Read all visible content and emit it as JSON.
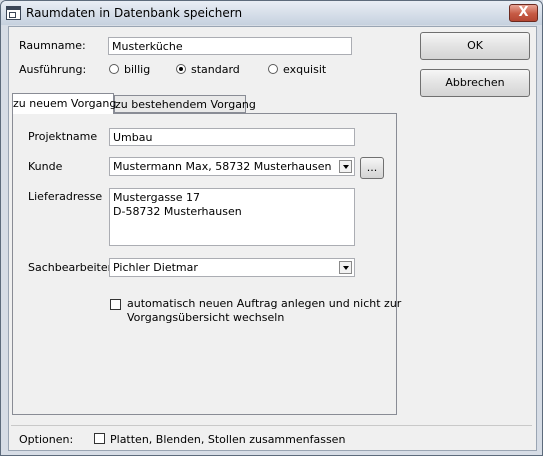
{
  "window": {
    "title": "Raumdaten in Datenbank speichern",
    "close_glyph": "X"
  },
  "raumname": {
    "label": "Raumname:",
    "value": "Musterküche"
  },
  "ausfuehrung": {
    "label": "Ausführung:",
    "options": [
      {
        "label": "billig",
        "checked": false
      },
      {
        "label": "standard",
        "checked": true
      },
      {
        "label": "exquisit",
        "checked": false
      }
    ]
  },
  "tabs": [
    {
      "label": "zu neuem Vorgang",
      "active": true
    },
    {
      "label": "zu bestehendem Vorgang",
      "active": false
    }
  ],
  "form": {
    "projektname": {
      "label": "Projektname",
      "value": "Umbau"
    },
    "kunde": {
      "label": "Kunde",
      "value": "Mustermann Max, 58732 Musterhausen",
      "browse_label": "..."
    },
    "lieferadresse": {
      "label": "Lieferadresse",
      "lines": [
        "Mustergasse 17",
        "D-58732 Musterhausen"
      ]
    },
    "sachbearbeiter": {
      "label": "Sachbearbeiter",
      "value": "Pichler Dietmar"
    },
    "auto_auftrag": {
      "checked": false,
      "lines": [
        "automatisch neuen Auftrag anlegen und nicht zur",
        "Vorgangsübersicht wechseln"
      ]
    }
  },
  "buttons": {
    "ok": "OK",
    "cancel": "Abbrechen"
  },
  "optionen": {
    "label": "Optionen:",
    "checkbox_label": "Platten, Blenden, Stollen zusammenfassen",
    "checked": false
  }
}
